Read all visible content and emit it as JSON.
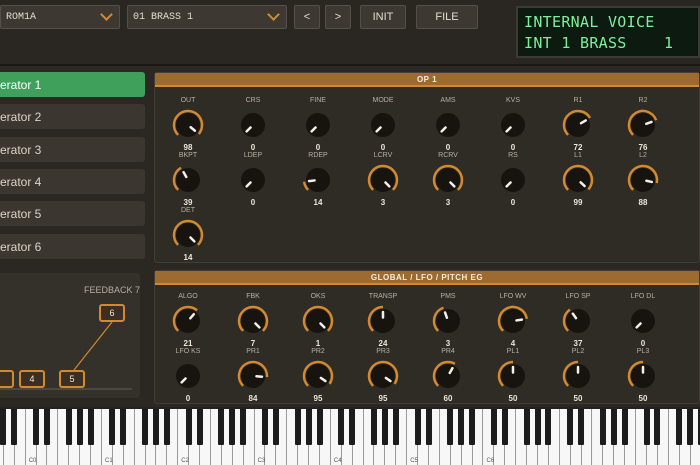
{
  "toolbar": {
    "bank": "ROM1A",
    "voice": "01 BRASS  1",
    "prev": "<",
    "next": ">",
    "init": "INIT",
    "file": "FILE"
  },
  "display": {
    "line1": "INTERNAL VOICE",
    "line2": "INT 1 BRASS    1"
  },
  "operators": [
    "erator 1",
    "erator 2",
    "erator 3",
    "erator 4",
    "erator 5",
    "erator 6"
  ],
  "active_operator_index": 0,
  "op_panel": {
    "title": "OP 1",
    "knobs": [
      {
        "label": "OUT",
        "value": "98",
        "level": 0.98
      },
      {
        "label": "CRS",
        "value": "0",
        "level": 0
      },
      {
        "label": "FINE",
        "value": "0",
        "level": 0
      },
      {
        "label": "MODE",
        "value": "0",
        "level": 0
      },
      {
        "label": "AMS",
        "value": "0",
        "level": 0
      },
      {
        "label": "KVS",
        "value": "0",
        "level": 0
      },
      {
        "label": "R1",
        "value": "72",
        "level": 0.72
      },
      {
        "label": "R2",
        "value": "76",
        "level": 0.76
      },
      {
        "label": "BKPT",
        "value": "39",
        "level": 0.39
      },
      {
        "label": "LDEP",
        "value": "0",
        "level": 0
      },
      {
        "label": "RDEP",
        "value": "14",
        "level": 0.14
      },
      {
        "label": "LCRV",
        "value": "3",
        "level": 1
      },
      {
        "label": "RCRV",
        "value": "3",
        "level": 1
      },
      {
        "label": "RS",
        "value": "0",
        "level": 0
      },
      {
        "label": "L1",
        "value": "99",
        "level": 0.99
      },
      {
        "label": "L2",
        "value": "88",
        "level": 0.88
      },
      {
        "label": "DET",
        "value": "14",
        "level": 1
      }
    ]
  },
  "global_panel": {
    "title": "GLOBAL  /  LFO  /  PITCH EG",
    "knobs": [
      {
        "label": "ALGO",
        "value": "21",
        "level": 0.65
      },
      {
        "label": "FBK",
        "value": "7",
        "level": 1
      },
      {
        "label": "OKS",
        "value": "1",
        "level": 1
      },
      {
        "label": "TRANSP",
        "value": "24",
        "level": 0.5
      },
      {
        "label": "PMS",
        "value": "3",
        "level": 0.43
      },
      {
        "label": "LFO WV",
        "value": "4",
        "level": 0.8
      },
      {
        "label": "LFO SP",
        "value": "37",
        "level": 0.37
      },
      {
        "label": "LFO DL",
        "value": "0",
        "level": 0
      },
      {
        "label": "LFO KS",
        "value": "0",
        "level": 0
      },
      {
        "label": "PR1",
        "value": "84",
        "level": 0.85
      },
      {
        "label": "PR2",
        "value": "95",
        "level": 0.96
      },
      {
        "label": "PR3",
        "value": "95",
        "level": 0.96
      },
      {
        "label": "PR4",
        "value": "60",
        "level": 0.61
      },
      {
        "label": "PL1",
        "value": "50",
        "level": 0.5
      },
      {
        "label": "PL2",
        "value": "50",
        "level": 0.5
      },
      {
        "label": "PL3",
        "value": "50",
        "level": 0.5
      }
    ]
  },
  "algorithm": {
    "feedback_label": "FEEDBACK 7",
    "boxes": [
      "6",
      "4",
      "5"
    ]
  },
  "keyboard": {
    "octave_labels": [
      "C0",
      "C1",
      "C2",
      "C3",
      "C4",
      "C5",
      "C6"
    ]
  },
  "colors": {
    "accent": "#d2892f",
    "active": "#3fa05b",
    "lcd_text": "#7eef9c"
  }
}
